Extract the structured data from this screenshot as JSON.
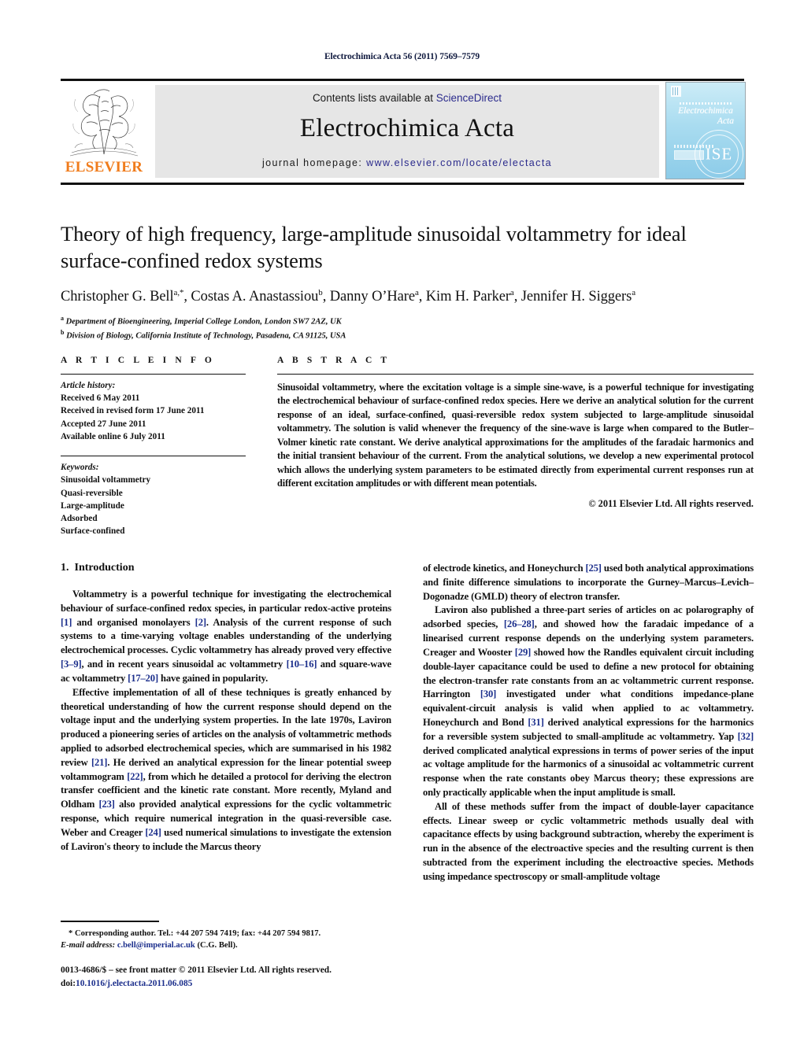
{
  "running_head": "Electrochimica Acta 56 (2011) 7569–7579",
  "masthead": {
    "contents_prefix": "Contents lists available at ",
    "contents_link": "ScienceDirect",
    "journal_title": "Electrochimica Acta",
    "homepage_prefix": "journal homepage: ",
    "homepage_url": "www.elsevier.com/locate/electacta",
    "publisher_logo_text": "ELSEVIER",
    "publisher_logo_color": "#f07c1c",
    "link_color": "#2a2a8c",
    "cover": {
      "title_line1": "Electrochimica",
      "title_line2": "Acta",
      "society_mark": "ISE",
      "background_color": "#a9dcf0"
    }
  },
  "article": {
    "title": "Theory of high frequency, large-amplitude sinusoidal voltammetry for ideal surface-confined redox systems",
    "authors_html": "Christopher G. Bell<sup>a,</sup><sup>*</sup>, Costas A. Anastassiou<sup>b</sup>, Danny O’Hare<sup>a</sup>, Kim H. Parker<sup>a</sup>, Jennifer H. Siggers<sup>a</sup>",
    "affiliations": [
      "Department of Bioengineering, Imperial College London, London SW7 2AZ, UK",
      "Division of Biology, California Institute of Technology, Pasadena, CA 91125, USA"
    ],
    "affiliation_marks": [
      "a",
      "b"
    ]
  },
  "article_info": {
    "heading": "A R T I C L E   I N F O",
    "history_label": "Article history:",
    "history": [
      "Received 6 May 2011",
      "Received in revised form 17 June 2011",
      "Accepted 27 June 2011",
      "Available online 6 July 2011"
    ],
    "keywords_label": "Keywords:",
    "keywords": [
      "Sinusoidal voltammetry",
      "Quasi-reversible",
      "Large-amplitude",
      "Adsorbed",
      "Surface-confined"
    ]
  },
  "abstract": {
    "heading": "A B S T R A C T",
    "text": "Sinusoidal voltammetry, where the excitation voltage is a simple sine-wave, is a powerful technique for investigating the electrochemical behaviour of surface-confined redox species. Here we derive an analytical solution for the current response of an ideal, surface-confined, quasi-reversible redox system subjected to large-amplitude sinusoidal voltammetry. The solution is valid whenever the frequency of the sine-wave is large when compared to the Butler–Volmer kinetic rate constant. We derive analytical approximations for the amplitudes of the faradaic harmonics and the initial transient behaviour of the current. From the analytical solutions, we develop a new experimental protocol which allows the underlying system parameters to be estimated directly from experimental current responses run at different excitation amplitudes or with different mean potentials.",
    "copyright": "© 2011 Elsevier Ltd. All rights reserved."
  },
  "introduction": {
    "section_number": "1.",
    "section_title": "Introduction",
    "left_paragraphs": [
      "Voltammetry is a powerful technique for investigating the electrochemical behaviour of surface-confined redox species, in particular redox-active proteins [1] and organised monolayers [2]. Analysis of the current response of such systems to a time-varying voltage enables understanding of the underlying electrochemical processes. Cyclic voltammetry has already proved very effective [3–9], and in recent years sinusoidal ac voltammetry [10–16] and square-wave ac voltammetry [17–20] have gained in popularity.",
      "Effective implementation of all of these techniques is greatly enhanced by theoretical understanding of how the current response should depend on the voltage input and the underlying system properties. In the late 1970s, Laviron produced a pioneering series of articles on the analysis of voltammetric methods applied to adsorbed electrochemical species, which are summarised in his 1982 review [21]. He derived an analytical expression for the linear potential sweep voltammogram [22], from which he detailed a protocol for deriving the electron transfer coefficient and the kinetic rate constant. More recently, Myland and Oldham [23] also provided analytical expressions for the cyclic voltammetric response, which require numerical integration in the quasi-reversible case. Weber and Creager [24] used numerical simulations to investigate the extension of Laviron's theory to include the Marcus theory"
    ],
    "right_paragraphs": [
      "of electrode kinetics, and Honeychurch [25] used both analytical approximations and finite difference simulations to incorporate the Gurney–Marcus–Levich–Dogonadze (GMLD) theory of electron transfer.",
      "Laviron also published a three-part series of articles on ac polarography of adsorbed species, [26–28], and showed how the faradaic impedance of a linearised current response depends on the underlying system parameters. Creager and Wooster [29] showed how the Randles equivalent circuit including double-layer capacitance could be used to define a new protocol for obtaining the electron-transfer rate constants from an ac voltammetric current response. Harrington [30] investigated under what conditions impedance-plane equivalent-circuit analysis is valid when applied to ac voltammetry. Honeychurch and Bond [31] derived analytical expressions for the harmonics for a reversible system subjected to small-amplitude ac voltammetry. Yap [32] derived complicated analytical expressions in terms of power series of the input ac voltage amplitude for the harmonics of a sinusoidal ac voltammetric current response when the rate constants obey Marcus theory; these expressions are only practically applicable when the input amplitude is small.",
      "All of these methods suffer from the impact of double-layer capacitance effects. Linear sweep or cyclic voltammetric methods usually deal with capacitance effects by using background subtraction, whereby the experiment is run in the absence of the electroactive species and the resulting current is then subtracted from the experiment including the electroactive species. Methods using impedance spectroscopy or small-amplitude voltage"
    ],
    "reference_link_color": "#1c2f8c"
  },
  "footnote": {
    "corresponding": "* Corresponding author. Tel.: +44 207 594 7419; fax: +44 207 594 9817.",
    "email_label": "E-mail address:",
    "email": "c.bell@imperial.ac.uk",
    "email_suffix": " (C.G. Bell)."
  },
  "colophon": {
    "issn_line": "0013-4686/$ – see front matter © 2011 Elsevier Ltd. All rights reserved.",
    "doi_prefix": "doi:",
    "doi": "10.1016/j.electacta.2011.06.085"
  }
}
